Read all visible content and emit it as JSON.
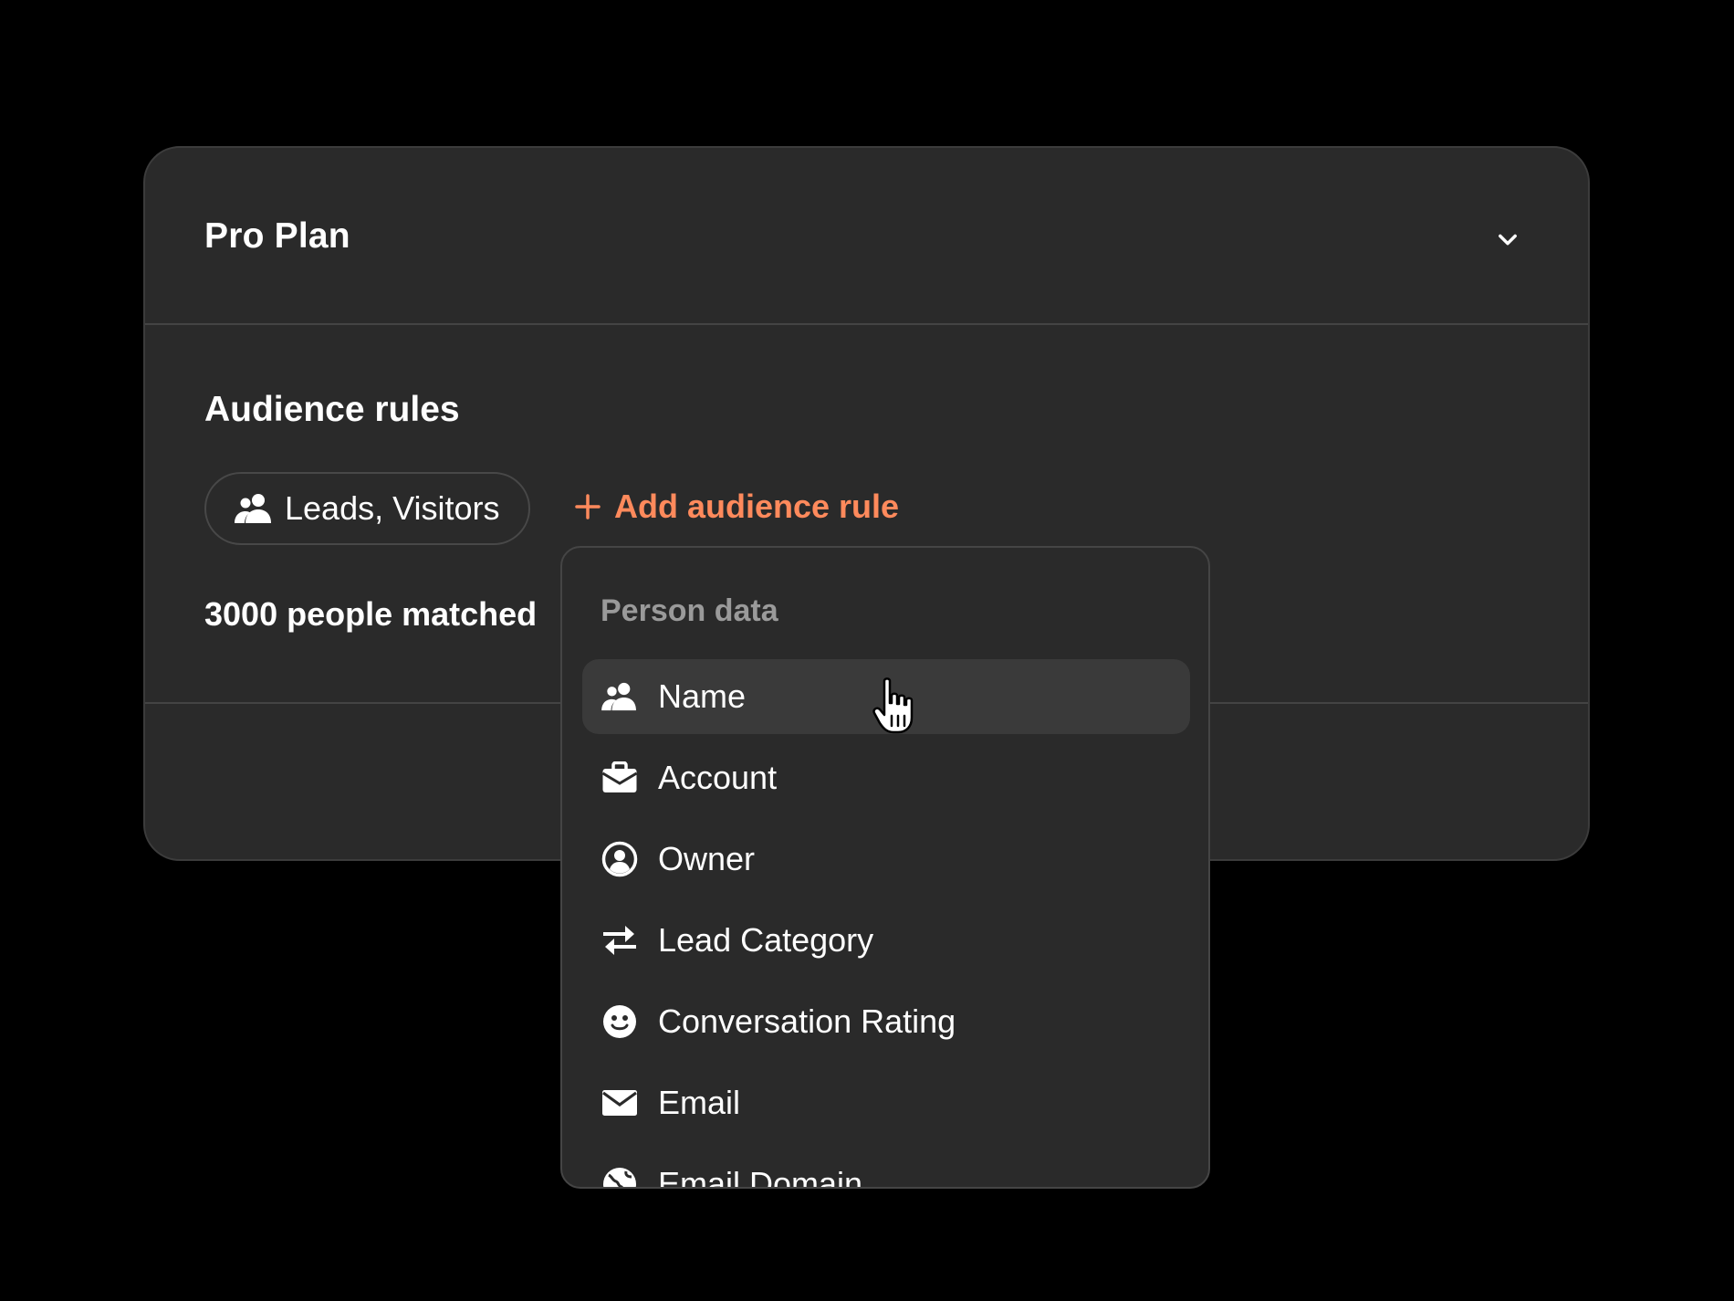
{
  "card": {
    "title": "Pro Plan",
    "section_title": "Audience rules",
    "audience_chip": {
      "icon": "people-icon",
      "label": "Leads, Visitors"
    },
    "add_rule": {
      "icon": "plus-icon",
      "label": "Add audience rule"
    },
    "matched_text": "3000 people matched"
  },
  "dropdown": {
    "header": "Person data",
    "items": [
      {
        "label": "Name",
        "icon": "people-icon",
        "hovered": true
      },
      {
        "label": "Account",
        "icon": "briefcase-icon"
      },
      {
        "label": "Owner",
        "icon": "user-circle-icon"
      },
      {
        "label": "Lead Category",
        "icon": "swap-arrows-icon"
      },
      {
        "label": "Conversation Rating",
        "icon": "smiley-icon"
      },
      {
        "label": "Email",
        "icon": "envelope-icon"
      },
      {
        "label": "Email Domain",
        "icon": "globe-icon"
      }
    ]
  },
  "colors": {
    "background": "#000000",
    "card": "#2a2a2a",
    "accent": "#ff8a5c",
    "muted_text": "#9a9a9a",
    "hover": "#3a3a3a"
  }
}
